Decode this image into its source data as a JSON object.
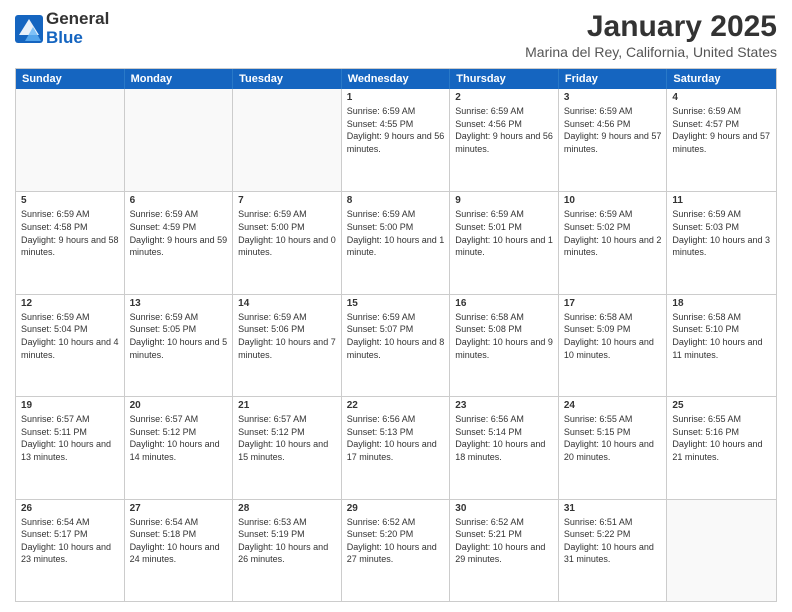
{
  "header": {
    "logo": {
      "line1": "General",
      "line2": "Blue"
    },
    "title": "January 2025",
    "subtitle": "Marina del Rey, California, United States"
  },
  "weekdays": [
    "Sunday",
    "Monday",
    "Tuesday",
    "Wednesday",
    "Thursday",
    "Friday",
    "Saturday"
  ],
  "weeks": [
    [
      {
        "empty": true
      },
      {
        "empty": true
      },
      {
        "empty": true
      },
      {
        "day": 1,
        "sunrise": "6:59 AM",
        "sunset": "4:55 PM",
        "daylight": "9 hours and 56 minutes."
      },
      {
        "day": 2,
        "sunrise": "6:59 AM",
        "sunset": "4:56 PM",
        "daylight": "9 hours and 56 minutes."
      },
      {
        "day": 3,
        "sunrise": "6:59 AM",
        "sunset": "4:56 PM",
        "daylight": "9 hours and 57 minutes."
      },
      {
        "day": 4,
        "sunrise": "6:59 AM",
        "sunset": "4:57 PM",
        "daylight": "9 hours and 57 minutes."
      }
    ],
    [
      {
        "day": 5,
        "sunrise": "6:59 AM",
        "sunset": "4:58 PM",
        "daylight": "9 hours and 58 minutes."
      },
      {
        "day": 6,
        "sunrise": "6:59 AM",
        "sunset": "4:59 PM",
        "daylight": "9 hours and 59 minutes."
      },
      {
        "day": 7,
        "sunrise": "6:59 AM",
        "sunset": "5:00 PM",
        "daylight": "10 hours and 0 minutes."
      },
      {
        "day": 8,
        "sunrise": "6:59 AM",
        "sunset": "5:00 PM",
        "daylight": "10 hours and 1 minute."
      },
      {
        "day": 9,
        "sunrise": "6:59 AM",
        "sunset": "5:01 PM",
        "daylight": "10 hours and 1 minute."
      },
      {
        "day": 10,
        "sunrise": "6:59 AM",
        "sunset": "5:02 PM",
        "daylight": "10 hours and 2 minutes."
      },
      {
        "day": 11,
        "sunrise": "6:59 AM",
        "sunset": "5:03 PM",
        "daylight": "10 hours and 3 minutes."
      }
    ],
    [
      {
        "day": 12,
        "sunrise": "6:59 AM",
        "sunset": "5:04 PM",
        "daylight": "10 hours and 4 minutes."
      },
      {
        "day": 13,
        "sunrise": "6:59 AM",
        "sunset": "5:05 PM",
        "daylight": "10 hours and 5 minutes."
      },
      {
        "day": 14,
        "sunrise": "6:59 AM",
        "sunset": "5:06 PM",
        "daylight": "10 hours and 7 minutes."
      },
      {
        "day": 15,
        "sunrise": "6:59 AM",
        "sunset": "5:07 PM",
        "daylight": "10 hours and 8 minutes."
      },
      {
        "day": 16,
        "sunrise": "6:58 AM",
        "sunset": "5:08 PM",
        "daylight": "10 hours and 9 minutes."
      },
      {
        "day": 17,
        "sunrise": "6:58 AM",
        "sunset": "5:09 PM",
        "daylight": "10 hours and 10 minutes."
      },
      {
        "day": 18,
        "sunrise": "6:58 AM",
        "sunset": "5:10 PM",
        "daylight": "10 hours and 11 minutes."
      }
    ],
    [
      {
        "day": 19,
        "sunrise": "6:57 AM",
        "sunset": "5:11 PM",
        "daylight": "10 hours and 13 minutes."
      },
      {
        "day": 20,
        "sunrise": "6:57 AM",
        "sunset": "5:12 PM",
        "daylight": "10 hours and 14 minutes."
      },
      {
        "day": 21,
        "sunrise": "6:57 AM",
        "sunset": "5:12 PM",
        "daylight": "10 hours and 15 minutes."
      },
      {
        "day": 22,
        "sunrise": "6:56 AM",
        "sunset": "5:13 PM",
        "daylight": "10 hours and 17 minutes."
      },
      {
        "day": 23,
        "sunrise": "6:56 AM",
        "sunset": "5:14 PM",
        "daylight": "10 hours and 18 minutes."
      },
      {
        "day": 24,
        "sunrise": "6:55 AM",
        "sunset": "5:15 PM",
        "daylight": "10 hours and 20 minutes."
      },
      {
        "day": 25,
        "sunrise": "6:55 AM",
        "sunset": "5:16 PM",
        "daylight": "10 hours and 21 minutes."
      }
    ],
    [
      {
        "day": 26,
        "sunrise": "6:54 AM",
        "sunset": "5:17 PM",
        "daylight": "10 hours and 23 minutes."
      },
      {
        "day": 27,
        "sunrise": "6:54 AM",
        "sunset": "5:18 PM",
        "daylight": "10 hours and 24 minutes."
      },
      {
        "day": 28,
        "sunrise": "6:53 AM",
        "sunset": "5:19 PM",
        "daylight": "10 hours and 26 minutes."
      },
      {
        "day": 29,
        "sunrise": "6:52 AM",
        "sunset": "5:20 PM",
        "daylight": "10 hours and 27 minutes."
      },
      {
        "day": 30,
        "sunrise": "6:52 AM",
        "sunset": "5:21 PM",
        "daylight": "10 hours and 29 minutes."
      },
      {
        "day": 31,
        "sunrise": "6:51 AM",
        "sunset": "5:22 PM",
        "daylight": "10 hours and 31 minutes."
      },
      {
        "empty": true
      }
    ]
  ]
}
